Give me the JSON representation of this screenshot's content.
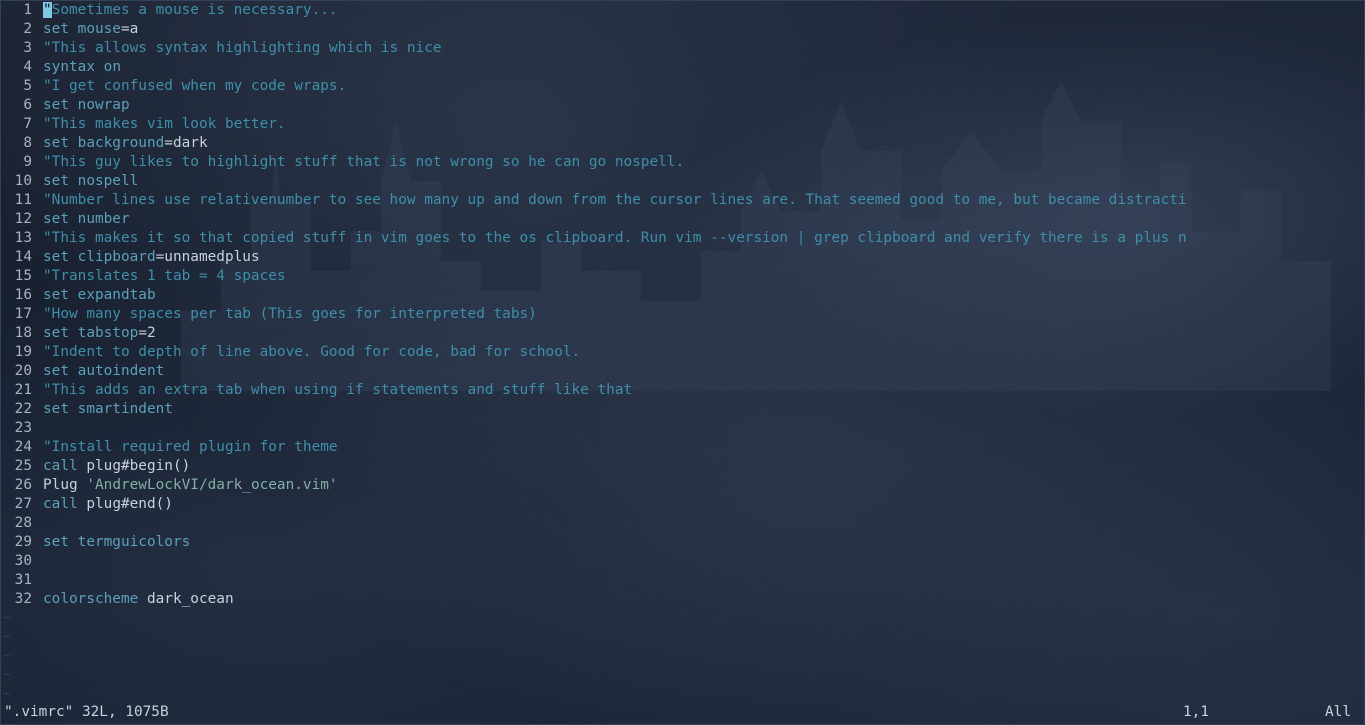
{
  "window": {
    "background": "#141b2a",
    "comment_color": "#3d8fa8",
    "keyword_color": "#5aa0b8",
    "cursor_color": "#7ec8e3"
  },
  "editor": {
    "lines": [
      {
        "num": "1",
        "parts": [
          {
            "t": "\"Sometimes a mouse is necessary...",
            "c": "comment"
          }
        ]
      },
      {
        "num": "2",
        "parts": [
          {
            "t": "set ",
            "c": "kw"
          },
          {
            "t": "mouse",
            "c": "kw"
          },
          {
            "t": "=a",
            "c": "ident"
          }
        ]
      },
      {
        "num": "3",
        "parts": [
          {
            "t": "\"This allows syntax highlighting which is nice",
            "c": "comment"
          }
        ]
      },
      {
        "num": "4",
        "parts": [
          {
            "t": "syntax ",
            "c": "kw"
          },
          {
            "t": "on",
            "c": "kw"
          }
        ]
      },
      {
        "num": "5",
        "parts": [
          {
            "t": "\"I get confused when my code wraps.",
            "c": "comment"
          }
        ]
      },
      {
        "num": "6",
        "parts": [
          {
            "t": "set ",
            "c": "kw"
          },
          {
            "t": "nowrap",
            "c": "kw"
          }
        ]
      },
      {
        "num": "7",
        "parts": [
          {
            "t": "\"This makes vim look better.",
            "c": "comment"
          }
        ]
      },
      {
        "num": "8",
        "parts": [
          {
            "t": "set ",
            "c": "kw"
          },
          {
            "t": "background",
            "c": "kw"
          },
          {
            "t": "=dark",
            "c": "ident"
          }
        ]
      },
      {
        "num": "9",
        "parts": [
          {
            "t": "\"This guy likes to highlight stuff that is not wrong so he can go nospell.",
            "c": "comment"
          }
        ]
      },
      {
        "num": "10",
        "parts": [
          {
            "t": "set ",
            "c": "kw"
          },
          {
            "t": "nospell",
            "c": "kw"
          }
        ]
      },
      {
        "num": "11",
        "parts": [
          {
            "t": "\"Number lines use relativenumber to see how many up and down from the cursor lines are. That seemed good to me, but became distracti",
            "c": "comment"
          }
        ]
      },
      {
        "num": "12",
        "parts": [
          {
            "t": "set ",
            "c": "kw"
          },
          {
            "t": "number",
            "c": "kw"
          }
        ]
      },
      {
        "num": "13",
        "parts": [
          {
            "t": "\"This makes it so that copied stuff in vim goes to the os clipboard. Run vim --version | grep clipboard and verify there is a plus n",
            "c": "comment"
          }
        ]
      },
      {
        "num": "14",
        "parts": [
          {
            "t": "set ",
            "c": "kw"
          },
          {
            "t": "clipboard",
            "c": "kw"
          },
          {
            "t": "=unnamedplus",
            "c": "ident"
          }
        ]
      },
      {
        "num": "15",
        "parts": [
          {
            "t": "\"Translates 1 tab = 4 spaces",
            "c": "comment"
          }
        ]
      },
      {
        "num": "16",
        "parts": [
          {
            "t": "set ",
            "c": "kw"
          },
          {
            "t": "expandtab",
            "c": "kw"
          }
        ]
      },
      {
        "num": "17",
        "parts": [
          {
            "t": "\"How many spaces per tab (This goes for interpreted tabs)",
            "c": "comment"
          }
        ]
      },
      {
        "num": "18",
        "parts": [
          {
            "t": "set ",
            "c": "kw"
          },
          {
            "t": "tabstop",
            "c": "kw"
          },
          {
            "t": "=2",
            "c": "ident"
          }
        ]
      },
      {
        "num": "19",
        "parts": [
          {
            "t": "\"Indent to depth of line above. Good for code, bad for school.",
            "c": "comment"
          }
        ]
      },
      {
        "num": "20",
        "parts": [
          {
            "t": "set ",
            "c": "kw"
          },
          {
            "t": "autoindent",
            "c": "kw"
          }
        ]
      },
      {
        "num": "21",
        "parts": [
          {
            "t": "\"This adds an extra tab when using if statements and stuff like that",
            "c": "comment"
          }
        ]
      },
      {
        "num": "22",
        "parts": [
          {
            "t": "set ",
            "c": "kw"
          },
          {
            "t": "smartindent",
            "c": "kw"
          }
        ]
      },
      {
        "num": "23",
        "parts": []
      },
      {
        "num": "24",
        "parts": [
          {
            "t": "\"Install required plugin for theme",
            "c": "comment"
          }
        ]
      },
      {
        "num": "25",
        "parts": [
          {
            "t": "call ",
            "c": "kw"
          },
          {
            "t": "plug#begin()",
            "c": "ident"
          }
        ]
      },
      {
        "num": "26",
        "parts": [
          {
            "t": "Plug ",
            "c": "ident"
          },
          {
            "t": "'AndrewLockVI/dark_ocean.vim'",
            "c": "str"
          }
        ]
      },
      {
        "num": "27",
        "parts": [
          {
            "t": "call ",
            "c": "kw"
          },
          {
            "t": "plug#end()",
            "c": "ident"
          }
        ]
      },
      {
        "num": "28",
        "parts": []
      },
      {
        "num": "29",
        "parts": [
          {
            "t": "set ",
            "c": "kw"
          },
          {
            "t": "termguicolors",
            "c": "kw"
          }
        ]
      },
      {
        "num": "30",
        "parts": []
      },
      {
        "num": "31",
        "parts": []
      },
      {
        "num": "32",
        "parts": [
          {
            "t": "colorscheme ",
            "c": "kw"
          },
          {
            "t": "dark_ocean",
            "c": "ident"
          }
        ]
      }
    ],
    "empty_line_marker": "~",
    "empty_line_count": 5
  },
  "status": {
    "file_info": "\".vimrc\" 32L, 1075B",
    "cursor_position": "1,1",
    "scroll_position": "All"
  }
}
